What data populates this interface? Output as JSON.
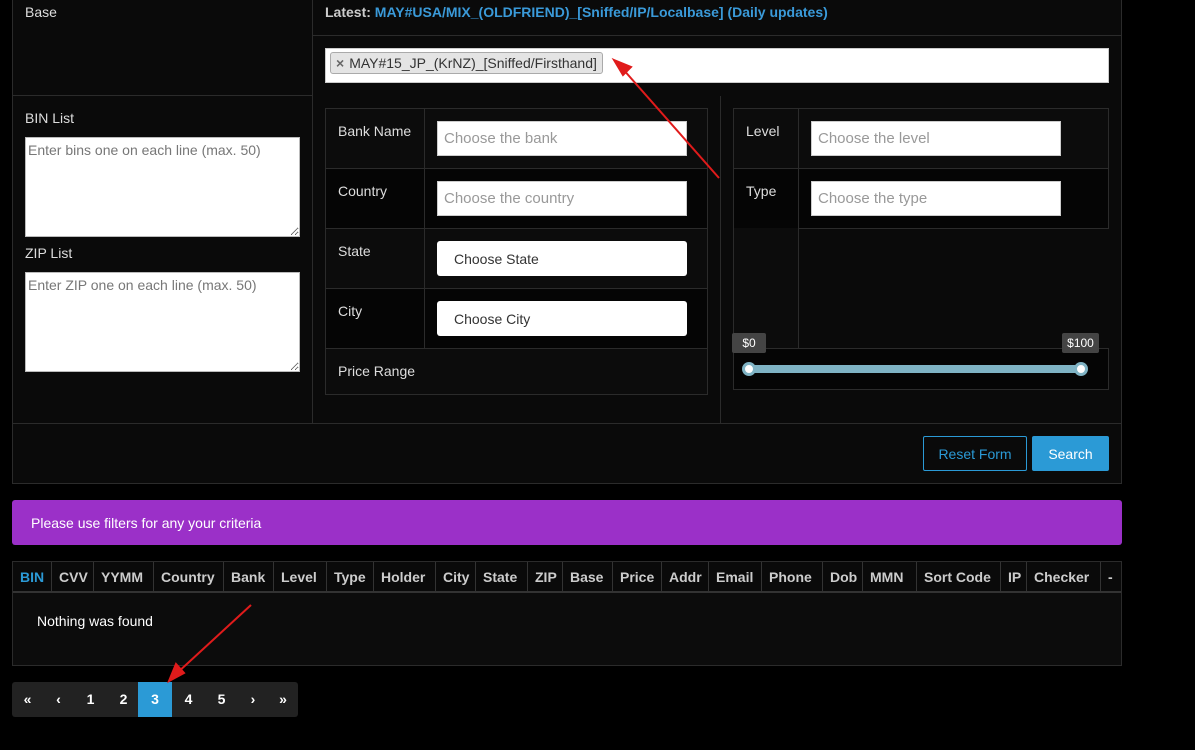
{
  "base": {
    "label": "Base",
    "latest_prefix": "Latest:",
    "latest_link": "MAY#USA/MIX_(OLDFRIEND)_[Sniffed/IP/Localbase] (Daily updates)",
    "tag": "MAY#15_JP_(KrNZ)_[Sniffed/Firsthand]",
    "tag_remove": "×"
  },
  "bin_list": {
    "label": "BIN List",
    "placeholder": "Enter bins one on each line (max. 50)"
  },
  "zip_list": {
    "label": "ZIP List",
    "placeholder": "Enter ZIP one on each line (max. 50)"
  },
  "filters": {
    "bank": {
      "label": "Bank Name",
      "placeholder": "Choose the bank"
    },
    "country": {
      "label": "Country",
      "placeholder": "Choose the country"
    },
    "state": {
      "label": "State",
      "button": "Choose State"
    },
    "city": {
      "label": "City",
      "button": "Choose City"
    },
    "price": {
      "label": "Price Range",
      "min_label": "$0",
      "max_label": "$100",
      "min": 0,
      "max": 100
    },
    "level": {
      "label": "Level",
      "placeholder": "Choose the level"
    },
    "type": {
      "label": "Type",
      "placeholder": "Choose the type"
    }
  },
  "actions": {
    "reset": "Reset Form",
    "search": "Search"
  },
  "alert": {
    "text": "Please use filters for any your criteria"
  },
  "table": {
    "columns": [
      "BIN",
      "CVV",
      "YYMM",
      "Country",
      "Bank",
      "Level",
      "Type",
      "Holder",
      "City",
      "State",
      "ZIP",
      "Base",
      "Price",
      "Addr",
      "Email",
      "Phone",
      "Dob",
      "MMN",
      "Sort Code",
      "IP",
      "Checker",
      "-"
    ],
    "empty": "Nothing was found"
  },
  "pagination": {
    "first": "«",
    "prev": "‹",
    "pages": [
      "1",
      "2",
      "3",
      "4",
      "5"
    ],
    "next": "›",
    "last": "»",
    "active": "3"
  },
  "colors": {
    "accent": "#2b9ad6",
    "alert": "#9b30c8",
    "link": "#3a9ad9",
    "slider": "#7fb3c4"
  }
}
